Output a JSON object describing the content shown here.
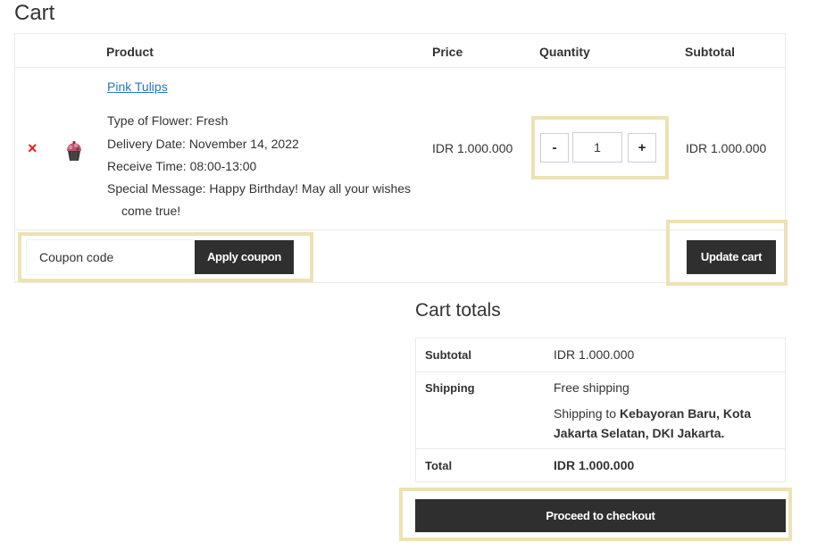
{
  "page": {
    "title": "Cart"
  },
  "cart": {
    "columns": {
      "product": "Product",
      "price": "Price",
      "quantity": "Quantity",
      "subtotal": "Subtotal"
    },
    "item": {
      "remove_symbol": "×",
      "thumbnail_icon": "cupcake-icon",
      "name": "Pink Tulips",
      "meta": {
        "type_label": "Type of Flower:",
        "type_value": "Fresh",
        "date_label": "Delivery Date:",
        "date_value": "November 14, 2022",
        "time_label": "Receive Time:",
        "time_value": "08:00-13:00",
        "message_label": "Special Message:",
        "message_value": "Happy Birthday! May all your wishes",
        "message_cont": "come true!"
      },
      "price": "IDR 1.000.000",
      "quantity": "1",
      "minus": "-",
      "plus": "+",
      "subtotal": "IDR 1.000.000"
    },
    "coupon": {
      "placeholder": "Coupon code",
      "apply_label": "Apply coupon"
    },
    "update_label": "Update cart"
  },
  "totals": {
    "title": "Cart totals",
    "subtotal_label": "Subtotal",
    "subtotal_value": "IDR 1.000.000",
    "shipping_label": "Shipping",
    "shipping_method": "Free shipping",
    "shipping_to_prefix": "Shipping to",
    "shipping_to_place": "Kebayoran Baru, Kota Jakarta Selatan, DKI Jakarta.",
    "total_label": "Total",
    "total_value": "IDR 1.000.000",
    "checkout_label": "Proceed to checkout"
  },
  "colors": {
    "highlight": "#ede2b5",
    "button_bg": "#2f2f2f",
    "link": "#2a73c5",
    "remove": "#e2231a"
  }
}
